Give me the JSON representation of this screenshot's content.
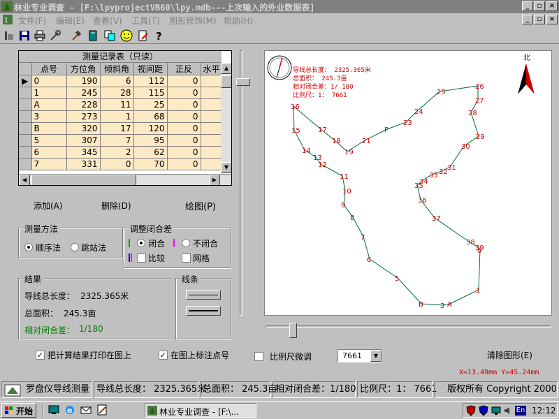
{
  "window": {
    "title": "林业专业调查 - [F:\\lpyprojectVB60\\lpy.mdb---上次输入的外业数据表]",
    "min": "_",
    "max": "▫",
    "close": "×"
  },
  "menu": [
    "文件(F)",
    "编辑(E)",
    "查看(V)",
    "工具(T)",
    "图形修饰(M)",
    "帮助(H)"
  ],
  "toolbar_icons": [
    "app-icon",
    "save-icon",
    "print-icon",
    "tools-icon",
    "hammer-icon",
    "book-icon",
    "copy-icon",
    "smiley-icon",
    "edit-icon",
    "help-icon"
  ],
  "table": {
    "caption": "测量记录表（只读）",
    "columns": [
      "点号",
      "方位角",
      "倾斜角",
      "视间距",
      "正反",
      "水平"
    ],
    "rows": [
      [
        "0",
        "190",
        "6",
        "112",
        "0"
      ],
      [
        "1",
        "245",
        "28",
        "115",
        "0"
      ],
      [
        "A",
        "228",
        "11",
        "25",
        "0"
      ],
      [
        "3",
        "273",
        "1",
        "68",
        "0"
      ],
      [
        "B",
        "320",
        "17",
        "120",
        "0"
      ],
      [
        "5",
        "307",
        "7",
        "95",
        "0"
      ],
      [
        "6",
        "345",
        "2",
        "62",
        "0"
      ],
      [
        "7",
        "331",
        "0",
        "70",
        "0"
      ]
    ]
  },
  "buttons": {
    "add": "添加(A)",
    "delete": "删除(D)",
    "draw": "绘图(P)",
    "clear": "清除图形(E)"
  },
  "method": {
    "title": "测量方法",
    "seq": "顺序法",
    "jump": "跳站法"
  },
  "closure": {
    "title": "调整闭合差",
    "close": "闭合",
    "open": "不闭合",
    "compare": "比较",
    "grid": "网格"
  },
  "result": {
    "title": "结果",
    "len_label": "导线总长度：",
    "len_value": "2325.365米",
    "area_label": "总面积：",
    "area_value": "245.3亩",
    "err_label": "相对闭合差：",
    "err_value": "1/180"
  },
  "lines": {
    "title": "线条"
  },
  "options": {
    "print_result": "把计算结果打印在图上",
    "label_points": "在图上标注点号",
    "scale_adjust": "比例尺微调",
    "scale_value": "7661"
  },
  "drawing": {
    "north": "北",
    "info": [
      "导线总长度：  2325.365米",
      "总面积：  245.3亩",
      "相对闭合差：1/ 180",
      "比例尺：1：  7661"
    ],
    "coords": "X=13.49mm Y=45.24mm",
    "points": [
      [
        "0",
        308,
        285
      ],
      [
        "1",
        306,
        342
      ],
      [
        "A",
        265,
        362
      ],
      [
        "3",
        255,
        364
      ],
      [
        "B",
        224,
        362
      ],
      [
        "5",
        190,
        325
      ],
      [
        "6",
        150,
        298
      ],
      [
        "7",
        141,
        266
      ],
      [
        "8",
        126,
        238
      ],
      [
        "9",
        113,
        220
      ],
      [
        "10",
        115,
        200
      ],
      [
        "11",
        111,
        179
      ],
      [
        "12",
        80,
        162
      ],
      [
        "13",
        73,
        152
      ],
      [
        "14",
        57,
        142
      ],
      [
        "15",
        42,
        113
      ],
      [
        "16",
        41,
        79
      ],
      [
        "17",
        80,
        112
      ],
      [
        "18",
        100,
        128
      ],
      [
        "19",
        118,
        144
      ],
      [
        "21",
        143,
        128
      ],
      [
        "P",
        175,
        112
      ],
      [
        "23",
        202,
        102
      ],
      [
        "24",
        218,
        86
      ],
      [
        "25",
        250,
        58
      ],
      [
        "26",
        305,
        50
      ],
      [
        "27",
        305,
        70
      ],
      [
        "28",
        295,
        88
      ],
      [
        "29",
        306,
        122
      ],
      [
        "30",
        285,
        136
      ],
      [
        "31",
        265,
        166
      ],
      [
        "32",
        253,
        172
      ],
      [
        "33",
        239,
        177
      ],
      [
        "34",
        225,
        186
      ],
      [
        "35",
        218,
        192
      ],
      [
        "36",
        223,
        213
      ],
      [
        "37",
        243,
        239
      ],
      [
        "38",
        292,
        273
      ],
      [
        "39",
        305,
        281
      ]
    ]
  },
  "statusbar": {
    "app": "罗盘仪导线测量",
    "len": "导线总长度：  2325.365米",
    "area": "总面积：  245.3亩",
    "err": "相对闭合差：1/180",
    "scale": "比例尺：1：  7661",
    "copyright": "版权所有 Copyright 2000"
  },
  "taskbar": {
    "start": "开始",
    "task": "林业专业调查 - [F:\\...",
    "lang": "En",
    "time": "12:12"
  },
  "colors": {
    "accent": "#000080",
    "drawing_red": "#cc0000",
    "traverse_green": "#006b3c",
    "grid_cell": "#fde9c4"
  }
}
